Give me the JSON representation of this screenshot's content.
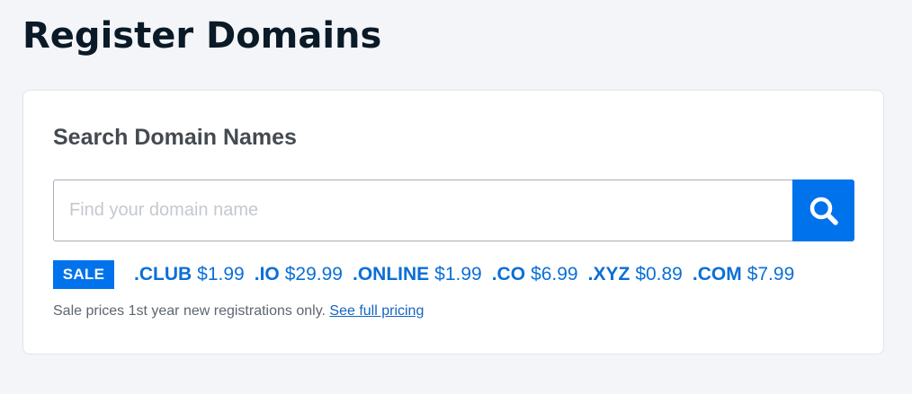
{
  "page": {
    "title": "Register Domains"
  },
  "search": {
    "heading": "Search Domain Names",
    "placeholder": "Find your domain name",
    "value": "",
    "button_icon": "search-icon"
  },
  "sale": {
    "badge": "SALE",
    "tlds": [
      {
        "name": ".CLUB",
        "price": "$1.99"
      },
      {
        "name": ".IO",
        "price": "$29.99"
      },
      {
        "name": ".ONLINE",
        "price": "$1.99"
      },
      {
        "name": ".CO",
        "price": "$6.99"
      },
      {
        "name": ".XYZ",
        "price": "$0.89"
      },
      {
        "name": ".COM",
        "price": "$7.99"
      }
    ],
    "note_text": "Sale prices 1st year new registrations only.",
    "note_link": "See full pricing"
  },
  "colors": {
    "background": "#f4f5f9",
    "accent": "#0073ec",
    "link": "#0b6fd6",
    "title": "#0a1a26"
  }
}
